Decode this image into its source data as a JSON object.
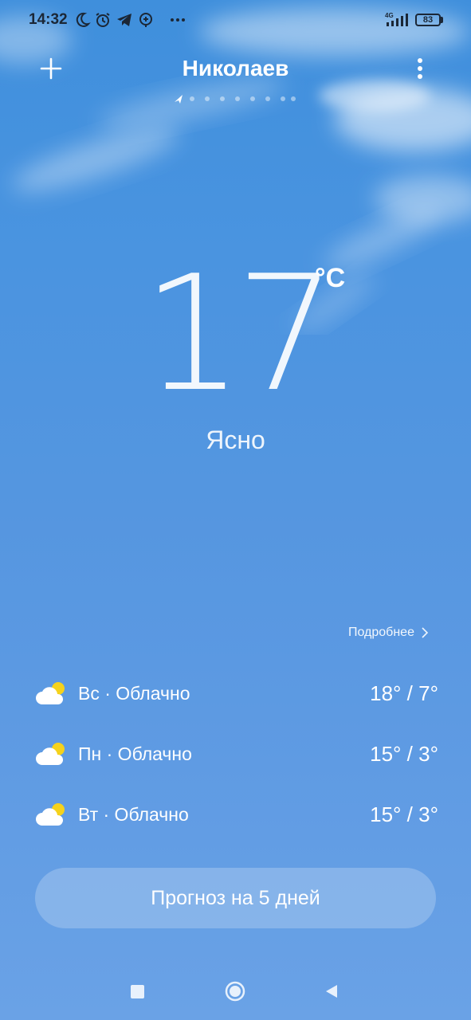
{
  "status_bar": {
    "time": "14:32",
    "network": "4G",
    "battery": "83",
    "icons": [
      "moon-icon",
      "alarm-icon",
      "telegram-icon",
      "plus-bubble-icon",
      "more-dots-icon",
      "signal-icon"
    ]
  },
  "header": {
    "city": "Николаев",
    "pages_total": 8,
    "current_page": 1,
    "icons": [
      "add-icon",
      "location-arrow-icon",
      "more-vertical-icon"
    ]
  },
  "current": {
    "temperature": "17",
    "unit": "°C",
    "condition": "Ясно"
  },
  "details": {
    "label": "Подробнее"
  },
  "forecast": [
    {
      "label": "Вс · Облачно",
      "temps": "18° / 7°",
      "icon": "partly-cloudy-icon"
    },
    {
      "label": "Пн · Облачно",
      "temps": "15° / 3°",
      "icon": "partly-cloudy-icon"
    },
    {
      "label": "Вт · Облачно",
      "temps": "15° / 3°",
      "icon": "partly-cloudy-icon"
    }
  ],
  "forecast_button": {
    "label": "Прогноз на 5 дней"
  },
  "colors": {
    "sky_top": "#3f8fdc",
    "sky_bottom": "#6aa2e6",
    "status_text": "#1b2736",
    "sun": "#f5d21c"
  }
}
